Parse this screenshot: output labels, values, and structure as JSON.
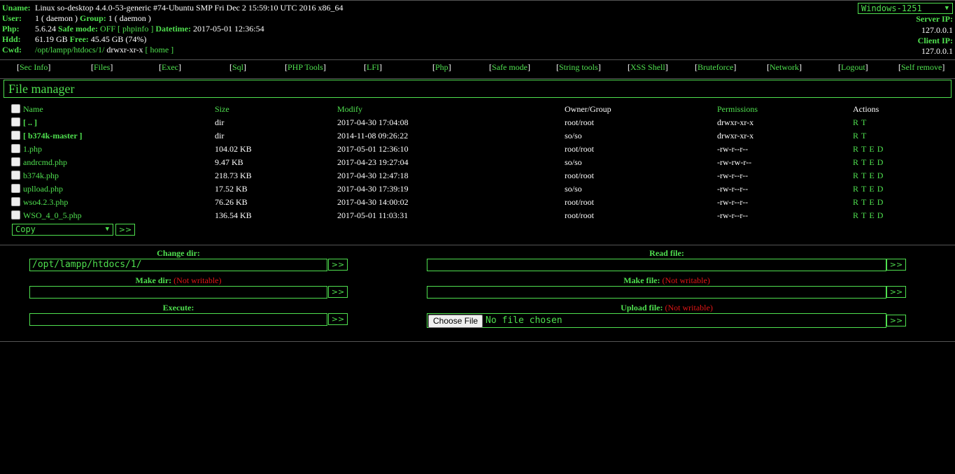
{
  "header": {
    "uname_label": "Uname:",
    "uname_value": "Linux so-desktop 4.4.0-53-generic #74-Ubuntu SMP Fri Dec 2 15:59:10 UTC 2016 x86_64",
    "user_label": "User:",
    "user_value": "1 ( daemon )",
    "group_label": "Group:",
    "group_value": "1 ( daemon )",
    "php_label": "Php:",
    "php_value": "5.6.24",
    "safe_mode_label": "Safe mode:",
    "safe_mode_value": "OFF",
    "phpinfo_link": "[ phpinfo ]",
    "datetime_label": "Datetime:",
    "datetime_value": "2017-05-01 12:36:54",
    "hdd_label": "Hdd:",
    "hdd_value": "61.19 GB",
    "free_label": "Free:",
    "free_value": "45.45 GB (74%)",
    "cwd_label": "Cwd:",
    "cwd_path": "/opt/lampp/htdocs/1/",
    "cwd_perms": "drwxr-xr-x",
    "home_link": "[ home ]",
    "charset": "Windows-1251",
    "server_ip_label": "Server IP:",
    "server_ip": "127.0.0.1",
    "client_ip_label": "Client IP:",
    "client_ip": "127.0.0.1"
  },
  "menu": [
    "Sec Info",
    "Files",
    "Exec",
    "Sql",
    "PHP Tools",
    "LFI",
    "Php",
    "Safe mode",
    "String tools",
    "XSS Shell",
    "Bruteforce",
    "Network",
    "Logout",
    "Self remove"
  ],
  "file_manager": {
    "title": "File manager",
    "columns": [
      "Name",
      "Size",
      "Modify",
      "Owner/Group",
      "Permissions",
      "Actions"
    ],
    "rows": [
      {
        "name": "[ .. ]",
        "size": "dir",
        "modify": "2017-04-30 17:04:08",
        "owner": "root/root",
        "perms": "drwxr-xr-x",
        "actions": [
          "R",
          "T"
        ]
      },
      {
        "name": "[ b374k-master ]",
        "size": "dir",
        "modify": "2014-11-08 09:26:22",
        "owner": "so/so",
        "perms": "drwxr-xr-x",
        "actions": [
          "R",
          "T"
        ]
      },
      {
        "name": "1.php",
        "size": "104.02 KB",
        "modify": "2017-05-01 12:36:10",
        "owner": "root/root",
        "perms": "-rw-r--r--",
        "actions": [
          "R",
          "T",
          "E",
          "D"
        ]
      },
      {
        "name": "andrcmd.php",
        "size": "9.47 KB",
        "modify": "2017-04-23 19:27:04",
        "owner": "so/so",
        "perms": "-rw-rw-r--",
        "actions": [
          "R",
          "T",
          "E",
          "D"
        ]
      },
      {
        "name": "b374k.php",
        "size": "218.73 KB",
        "modify": "2017-04-30 12:47:18",
        "owner": "root/root",
        "perms": "-rw-r--r--",
        "actions": [
          "R",
          "T",
          "E",
          "D"
        ]
      },
      {
        "name": "uplload.php",
        "size": "17.52 KB",
        "modify": "2017-04-30 17:39:19",
        "owner": "so/so",
        "perms": "-rw-r--r--",
        "actions": [
          "R",
          "T",
          "E",
          "D"
        ]
      },
      {
        "name": "wso4.2.3.php",
        "size": "76.26 KB",
        "modify": "2017-04-30 14:00:02",
        "owner": "root/root",
        "perms": "-rw-r--r--",
        "actions": [
          "R",
          "T",
          "E",
          "D"
        ]
      },
      {
        "name": "WSO_4_0_5.php",
        "size": "136.54 KB",
        "modify": "2017-05-01 11:03:31",
        "owner": "root/root",
        "perms": "-rw-r--r--",
        "actions": [
          "R",
          "T",
          "E",
          "D"
        ]
      }
    ],
    "bulk_action": "Copy",
    "go_button": ">>"
  },
  "forms": {
    "change_dir_label": "Change dir:",
    "change_dir_value": "/opt/lampp/htdocs/1/",
    "make_dir_label": "Make dir:",
    "execute_label": "Execute:",
    "read_file_label": "Read file:",
    "make_file_label": "Make file:",
    "upload_file_label": "Upload file:",
    "not_writable": "(Not writable)",
    "choose_file": "Choose File",
    "no_file": "No file chosen",
    "submit": ">>"
  }
}
